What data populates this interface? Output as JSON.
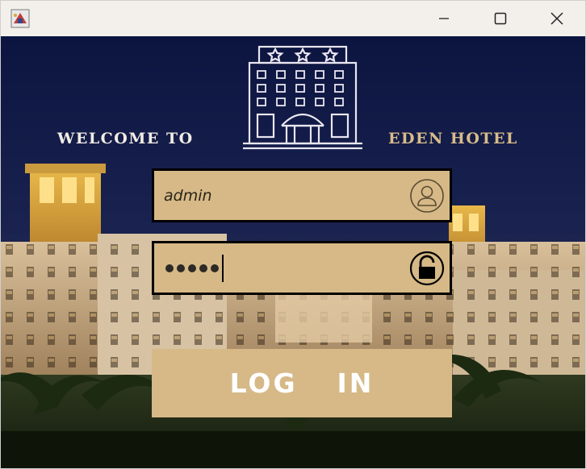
{
  "window": {
    "icons": {
      "app": "app-logo-icon",
      "minimize": "minimize-icon",
      "maximize": "maximize-icon",
      "close": "close-icon"
    }
  },
  "header": {
    "welcome": "WELCOME TO",
    "hotel_name": "EDEN HOTEL",
    "logo_icon": "hotel-building-icon"
  },
  "form": {
    "username": {
      "value": "admin",
      "icon": "user-icon"
    },
    "password": {
      "masked_length": 5,
      "icon": "lock-icon"
    },
    "login_label": "LOG  IN"
  },
  "colors": {
    "field_bg": "#d6b987",
    "accent_text": "#d8bc8a",
    "sky": "#101a45"
  }
}
